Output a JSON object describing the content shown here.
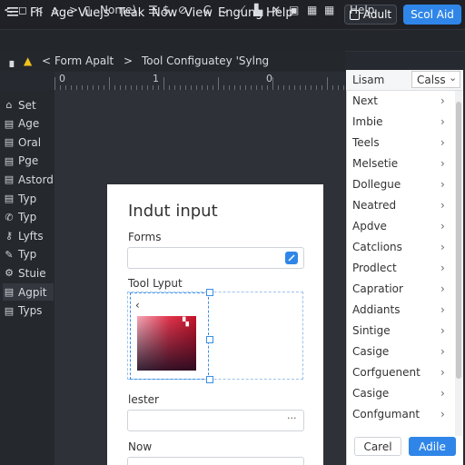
{
  "colors": {
    "accent": "#2f86e8",
    "dark_bg": "#26292f",
    "panel_bg": "#ffffff"
  },
  "menubar": {
    "items": [
      "Fil",
      "Age",
      "Vuejs",
      "Teak",
      "Now",
      "View",
      "Engung",
      "Help"
    ],
    "adult_label": "Adult",
    "scout_label": "Scol Aid"
  },
  "toolbar": {
    "name_label": "Nome)",
    "help_label": "Help"
  },
  "breadcrumb": {
    "item1": "Form Apalt",
    "item2": "Tool Configuatey 'Sylng"
  },
  "ruler": {
    "labels": [
      "0",
      "1",
      "0"
    ]
  },
  "sidebar": {
    "items": [
      {
        "label": "Set",
        "icon": "home-icon"
      },
      {
        "label": "Age",
        "icon": "grid-icon"
      },
      {
        "label": "Oral",
        "icon": "grid-icon"
      },
      {
        "label": "Pge",
        "icon": "grid-icon"
      },
      {
        "label": "Astord",
        "icon": "grid-icon"
      },
      {
        "label": "Typ",
        "icon": "grid-icon"
      },
      {
        "label": "Typ",
        "icon": "phone-icon"
      },
      {
        "label": "Lyfts",
        "icon": "wrench-icon"
      },
      {
        "label": "Typ",
        "icon": "pen-icon"
      },
      {
        "label": "Stuie",
        "icon": "gear-icon"
      },
      {
        "label": "Agpit",
        "icon": "grid-icon"
      },
      {
        "label": "Typs",
        "icon": "grid-icon"
      }
    ]
  },
  "panel": {
    "title": "Indut input",
    "forms_label": "Forms",
    "tool_label": "Tool Lyput",
    "lester_label": "lester",
    "now_label": "Now",
    "more_glyph": "···"
  },
  "list": {
    "header_left": "Lisam",
    "header_right": "Calss",
    "items": [
      "Next",
      "Imbie",
      "Teels",
      "Melsetie",
      "Dollegue",
      "Neatred",
      "Apdve",
      "Catclions",
      "Prodlect",
      "Capratior",
      "Addiants",
      "Sintige",
      "Casige",
      "Corfguenent",
      "Casige",
      "Confgumant"
    ],
    "cancel_label": "Carel",
    "add_label": "Adile"
  }
}
